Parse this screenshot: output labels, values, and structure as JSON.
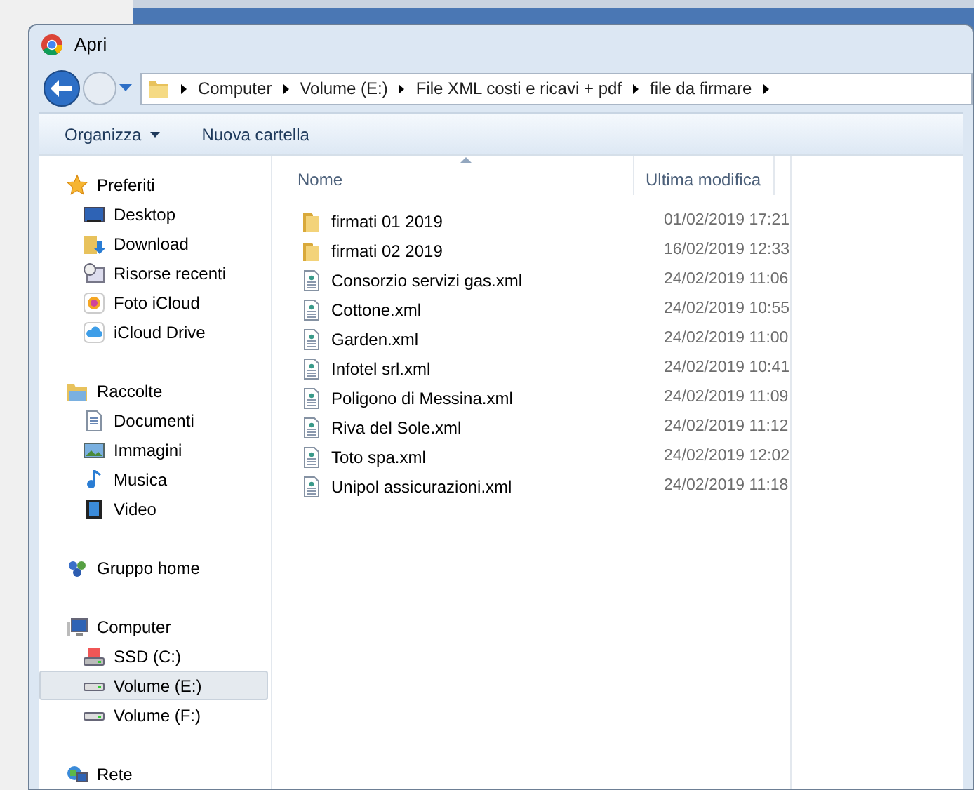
{
  "window": {
    "title": "Apri"
  },
  "breadcrumb": [
    "Computer",
    "Volume (E:)",
    "File XML costi e ricavi + pdf",
    "file da firmare"
  ],
  "toolbar": {
    "organize": "Organizza",
    "new_folder": "Nuova cartella"
  },
  "sidebar": [
    {
      "label": "Preferiti",
      "selected": false,
      "children": [
        {
          "label": "Desktop",
          "selected": false
        },
        {
          "label": "Download",
          "selected": false
        },
        {
          "label": "Risorse recenti",
          "selected": false
        },
        {
          "label": "Foto iCloud",
          "selected": false
        },
        {
          "label": "iCloud Drive",
          "selected": false
        }
      ]
    },
    {
      "label": "Raccolte",
      "selected": false,
      "children": [
        {
          "label": "Documenti",
          "selected": false
        },
        {
          "label": "Immagini",
          "selected": false
        },
        {
          "label": "Musica",
          "selected": false
        },
        {
          "label": "Video",
          "selected": false
        }
      ]
    },
    {
      "label": "Gruppo home",
      "selected": false
    },
    {
      "label": "Computer",
      "selected": false,
      "children": [
        {
          "label": "SSD (C:)",
          "selected": false
        },
        {
          "label": "Volume (E:)",
          "selected": true
        },
        {
          "label": "Volume (F:)",
          "selected": false
        }
      ]
    },
    {
      "label": "Rete",
      "selected": false
    }
  ],
  "table": {
    "columns": [
      "Nome",
      "Ultima modifica"
    ],
    "rows": [
      {
        "kind": "folder",
        "name": "firmati 01 2019",
        "modified": "01/02/2019 17:21"
      },
      {
        "kind": "folder",
        "name": "firmati 02 2019",
        "modified": "16/02/2019 12:33"
      },
      {
        "kind": "file",
        "name": "Consorzio servizi gas.xml",
        "modified": "24/02/2019 11:06"
      },
      {
        "kind": "file",
        "name": "Cottone.xml",
        "modified": "24/02/2019 10:55"
      },
      {
        "kind": "file",
        "name": "Garden.xml",
        "modified": "24/02/2019 11:00"
      },
      {
        "kind": "file",
        "name": "Infotel srl.xml",
        "modified": "24/02/2019 10:41"
      },
      {
        "kind": "file",
        "name": "Poligono di Messina.xml",
        "modified": "24/02/2019 11:09"
      },
      {
        "kind": "file",
        "name": "Riva del Sole.xml",
        "modified": "24/02/2019 11:12"
      },
      {
        "kind": "file",
        "name": "Toto spa.xml",
        "modified": "24/02/2019 12:02"
      },
      {
        "kind": "file",
        "name": "Unipol assicurazioni.xml",
        "modified": "24/02/2019 11:18"
      }
    ]
  }
}
